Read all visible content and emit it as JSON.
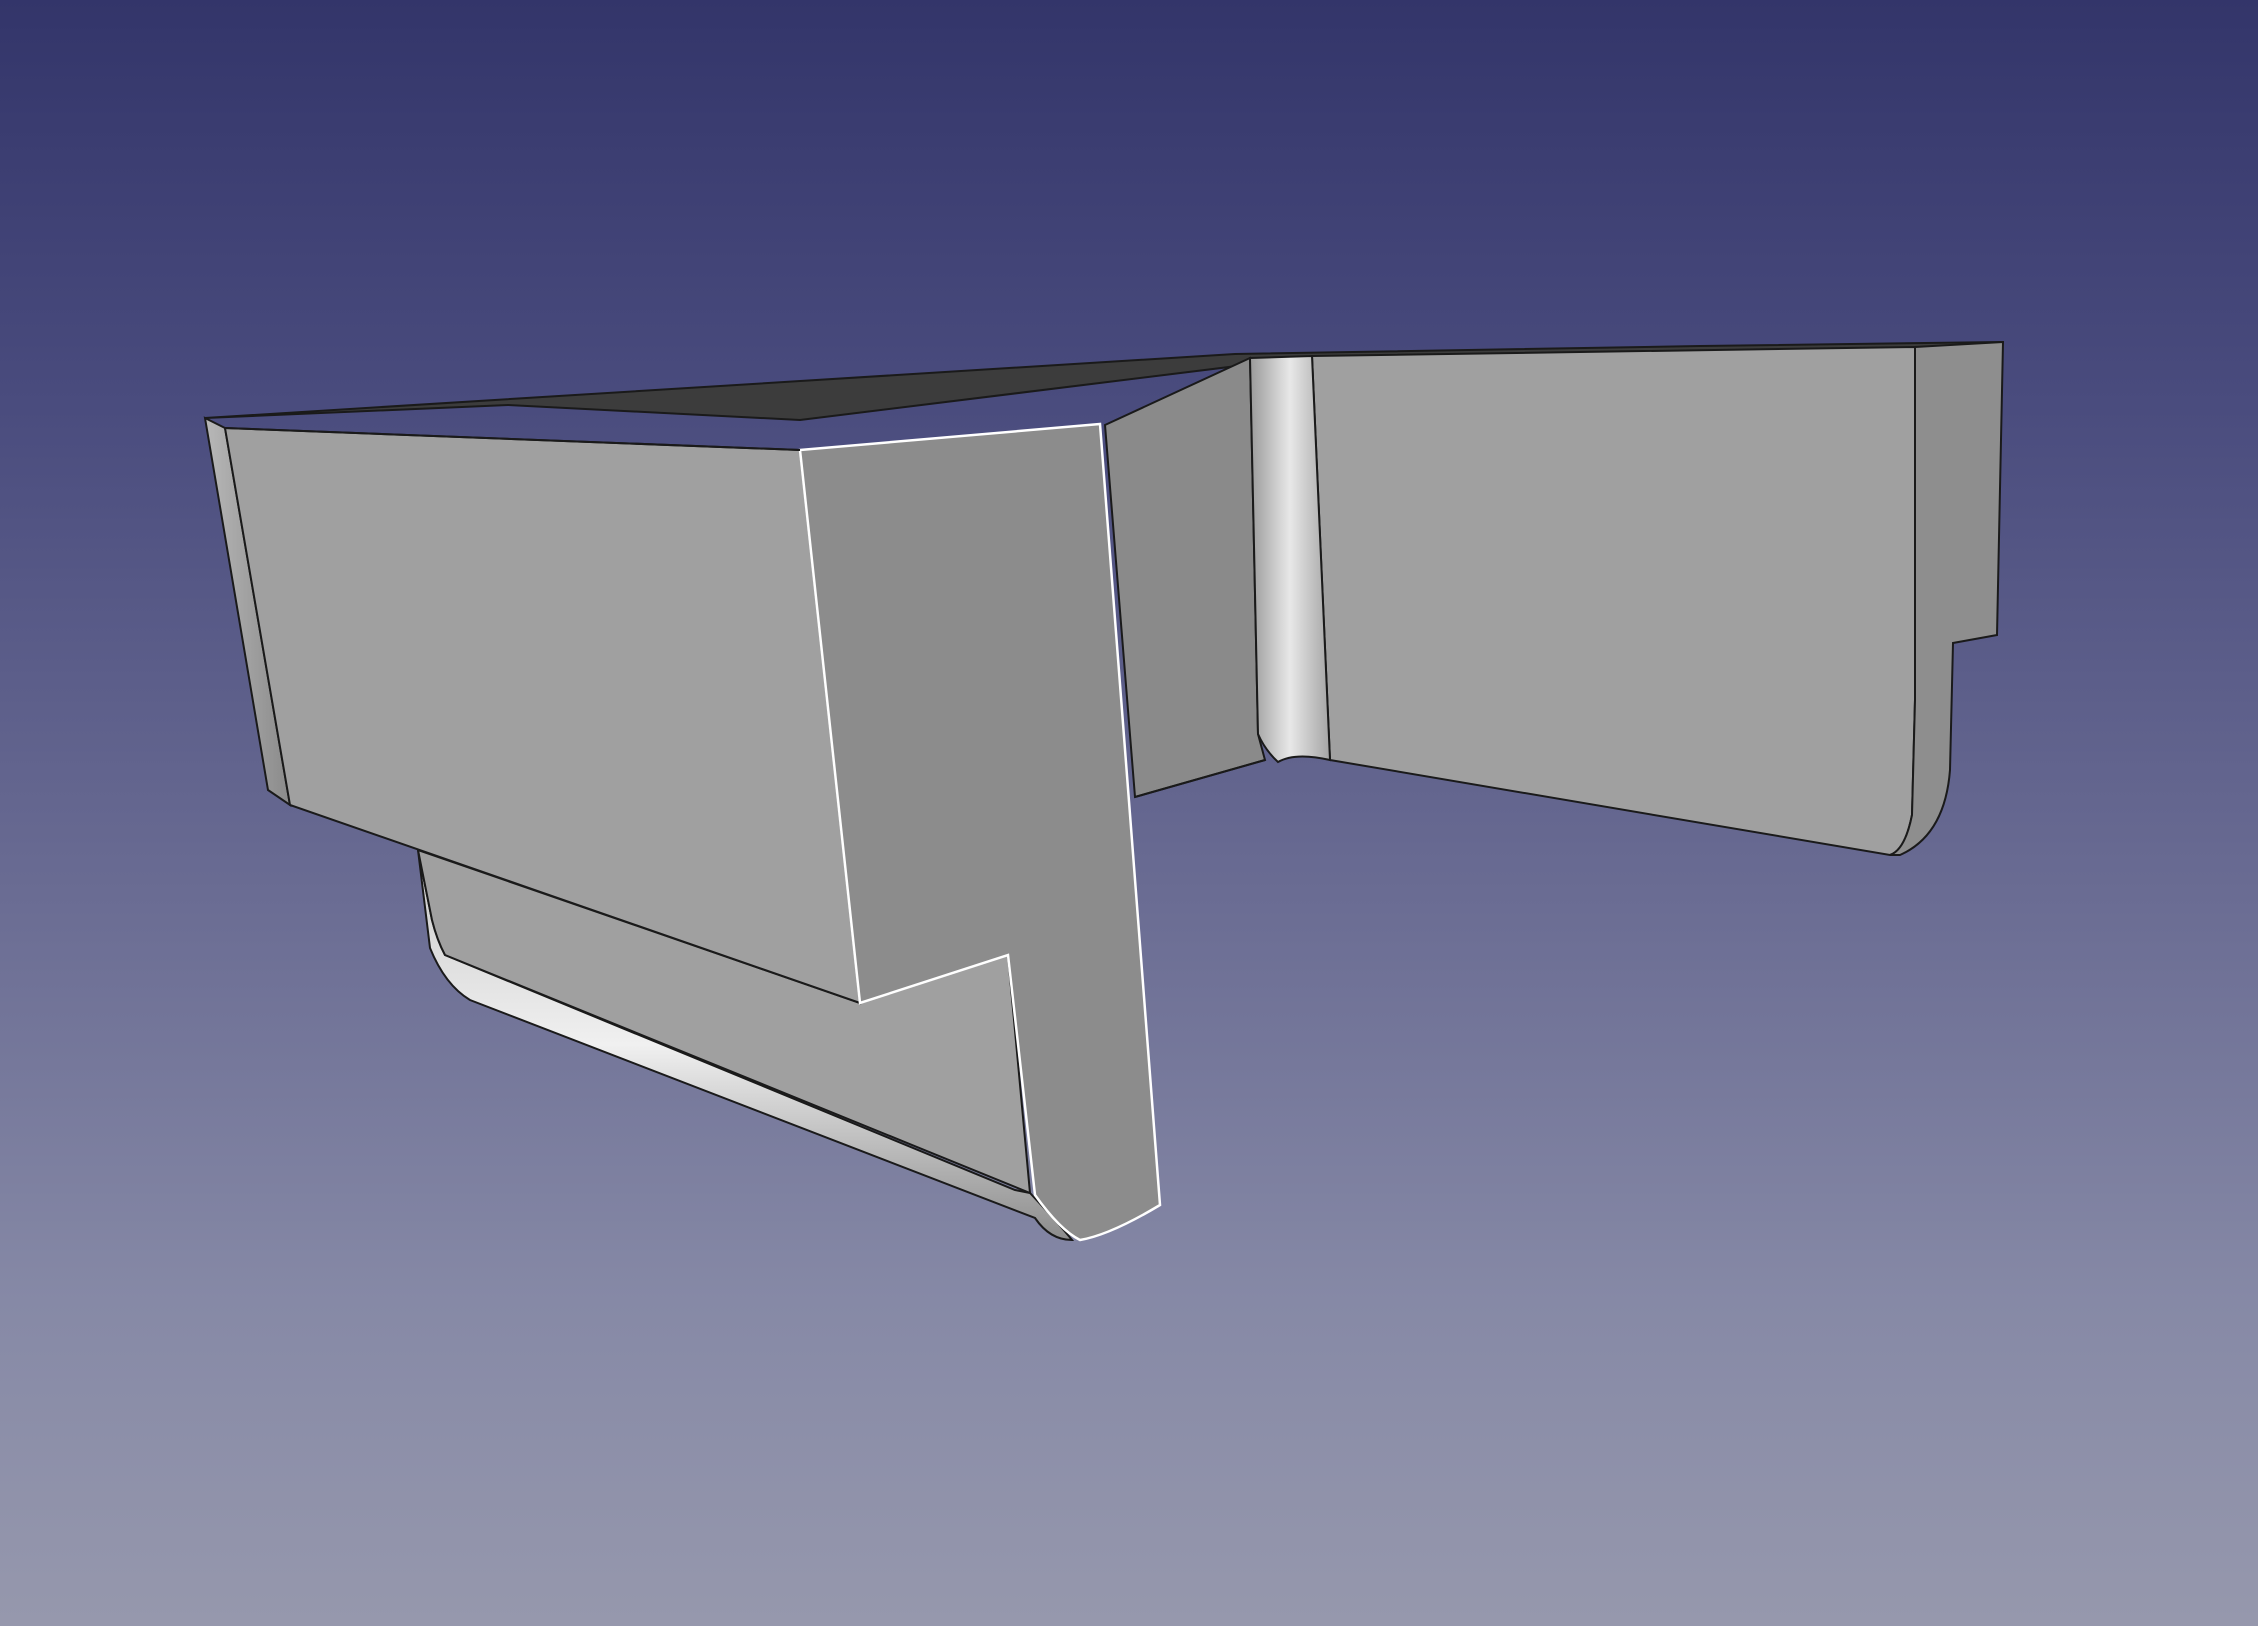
{
  "viewport": {
    "background_top": "#33356a",
    "background_bottom": "#9698ad"
  },
  "model": {
    "face_light": "#a0a0a0",
    "face_mid": "#8c8c8c",
    "face_dark": "#3c3c3c",
    "edge_color": "#1a1a1a",
    "highlight_edge_color": "#ffffff"
  }
}
